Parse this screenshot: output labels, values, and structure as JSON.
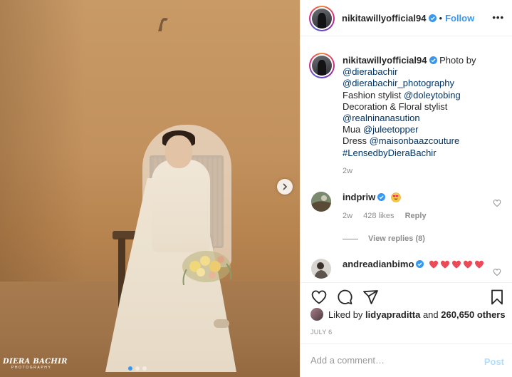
{
  "photo": {
    "watermark_main": "DIERA BACHIR",
    "watermark_sub": "PHOTOGRAPHY",
    "carousel_total": 3,
    "carousel_index": 1
  },
  "header": {
    "username": "nikitawillyofficial94",
    "separator": "•",
    "follow_label": "Follow",
    "more_label": "•••"
  },
  "caption": {
    "username": "nikitawillyofficial94",
    "lines": [
      [
        {
          "t": "Photo by",
          "m": false
        }
      ],
      [
        {
          "t": "@dierabachir",
          "m": true
        }
      ],
      [
        {
          "t": "@dierabachir_photography",
          "m": true
        }
      ],
      [
        {
          "t": "Fashion stylist ",
          "m": false
        },
        {
          "t": "@doleytobing",
          "m": true
        }
      ],
      [
        {
          "t": "Decoration & Floral stylist",
          "m": false
        }
      ],
      [
        {
          "t": "@realninanasution",
          "m": true
        }
      ],
      [
        {
          "t": "Mua ",
          "m": false
        },
        {
          "t": "@juleetopper",
          "m": true
        }
      ],
      [
        {
          "t": "Dress ",
          "m": false
        },
        {
          "t": "@maisonbaazcouture",
          "m": true
        }
      ],
      [
        {
          "t": "#LensedbyDieraBachir",
          "m": true
        }
      ]
    ],
    "time": "2w"
  },
  "comments": [
    {
      "username": "indpriw",
      "emoji": "heart-eyes-emoji",
      "time": "2w",
      "likes": "428 likes",
      "reply_label": "Reply",
      "view_replies": "View replies (8)"
    },
    {
      "username": "andreadianbimo",
      "hearts": 5
    }
  ],
  "likes": {
    "prefix": "Liked by ",
    "user": "lidyapraditta",
    "middle": " and ",
    "count": "260,650 others"
  },
  "date": "JULY 6",
  "add_comment": {
    "placeholder": "Add a comment…",
    "post_label": "Post"
  },
  "colors": {
    "accent": "#3897f0",
    "verified": "#3897f0",
    "heart_red": "#ed4956",
    "post_disabled": "#b2dffc"
  },
  "icons": [
    "chevron-right-icon",
    "verified-icon",
    "heart-icon",
    "comment-icon",
    "share-icon",
    "bookmark-icon",
    "heart-eyes-emoji",
    "red-heart-emoji"
  ]
}
